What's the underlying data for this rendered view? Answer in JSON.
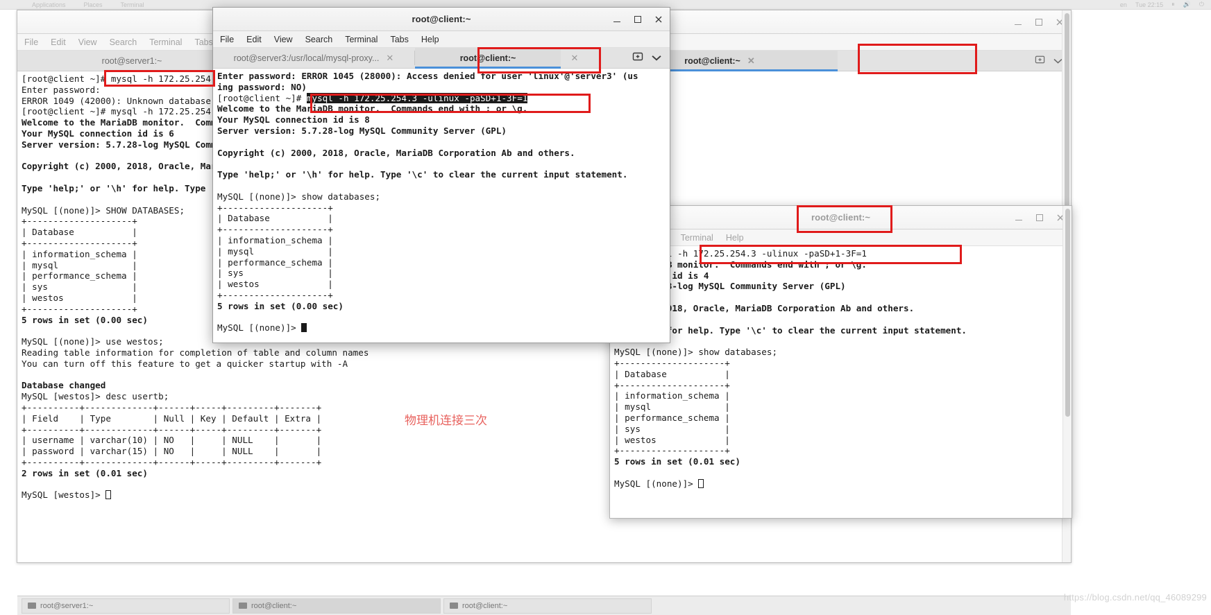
{
  "panel": {
    "menus": [
      "Applications",
      "Places",
      "Terminal"
    ],
    "right_items": [
      "en",
      "Tue 22:15",
      "⏸",
      "🔊",
      "⏻"
    ]
  },
  "window_back": {
    "title": "root@server1:~",
    "menubar": [
      "File",
      "Edit",
      "View",
      "Search",
      "Terminal",
      "Tabs",
      "Help"
    ],
    "tabs": [
      {
        "label": "root@server1:~",
        "active": false
      },
      {
        "label": "root@client:~",
        "active": true
      }
    ],
    "buttons": {
      "minimize": "minimize-icon",
      "maximize": "maximize-icon",
      "close": "close-icon"
    },
    "terminal_lines": [
      {
        "t": "[root@client ~]# mysql -h 172.25.254.3 -ulinux -pSD+1-3F=1 westoss",
        "bold": false
      },
      {
        "t": "Enter password:",
        "bold": false
      },
      {
        "t": "ERROR 1049 (42000): Unknown database 'westoss'",
        "bold": false
      },
      {
        "t": "[root@client ~]# mysql -h 172.25.254.3 -ulinux -pSD+1-3F=1",
        "bold": false
      },
      {
        "t": "Welcome to the MariaDB monitor.  Commands end with ; or \\g.",
        "bold": true
      },
      {
        "t": "Your MySQL connection id is 6",
        "bold": true
      },
      {
        "t": "Server version: 5.7.28-log MySQL Community Server (GPL)",
        "bold": true
      },
      {
        "t": "",
        "bold": false
      },
      {
        "t": "Copyright (c) 2000, 2018, Oracle, MariaDB Corporation Ab and others.",
        "bold": true
      },
      {
        "t": "",
        "bold": false
      },
      {
        "t": "Type 'help;' or '\\h' for help. Type '\\c' to clear the current input statement.",
        "bold": true
      },
      {
        "t": "",
        "bold": false
      },
      {
        "t": "MySQL [(none)]> SHOW DATABASES;",
        "bold": false
      },
      {
        "t": "+--------------------+",
        "bold": false
      },
      {
        "t": "| Database           |",
        "bold": false
      },
      {
        "t": "+--------------------+",
        "bold": false
      },
      {
        "t": "| information_schema |",
        "bold": false
      },
      {
        "t": "| mysql              |",
        "bold": false
      },
      {
        "t": "| performance_schema |",
        "bold": false
      },
      {
        "t": "| sys                |",
        "bold": false
      },
      {
        "t": "| westos             |",
        "bold": false
      },
      {
        "t": "+--------------------+",
        "bold": false
      },
      {
        "t": "5 rows in set (0.00 sec)",
        "bold": true
      },
      {
        "t": "",
        "bold": false
      },
      {
        "t": "MySQL [(none)]> use westos;",
        "bold": false
      },
      {
        "t": "Reading table information for completion of table and column names",
        "bold": false
      },
      {
        "t": "You can turn off this feature to get a quicker startup with -A",
        "bold": false
      },
      {
        "t": "",
        "bold": false
      },
      {
        "t": "Database changed",
        "bold": true
      },
      {
        "t": "MySQL [westos]> desc usertb;",
        "bold": false
      },
      {
        "t": "+----------+-------------+------+-----+---------+-------+",
        "bold": false
      },
      {
        "t": "| Field    | Type        | Null | Key | Default | Extra |",
        "bold": false
      },
      {
        "t": "+----------+-------------+------+-----+---------+-------+",
        "bold": false
      },
      {
        "t": "| username | varchar(10) | NO   |     | NULL    |       |",
        "bold": false
      },
      {
        "t": "| password | varchar(15) | NO   |     | NULL    |       |",
        "bold": false
      },
      {
        "t": "+----------+-------------+------+-----+---------+-------+",
        "bold": false
      },
      {
        "t": "2 rows in set (0.01 sec)",
        "bold": true
      },
      {
        "t": "",
        "bold": false
      },
      {
        "t": "MySQL [westos]> ",
        "bold": false,
        "cursor": "hollow"
      }
    ]
  },
  "window_center": {
    "title": "root@client:~",
    "menubar": [
      "File",
      "Edit",
      "View",
      "Search",
      "Terminal",
      "Tabs",
      "Help"
    ],
    "tabs": [
      {
        "label": "root@server3:/usr/local/mysql-proxy...",
        "active": false
      },
      {
        "label": "root@client:~",
        "active": true
      }
    ],
    "tab_tools": {
      "new_tab": "new-tab-icon",
      "tab_list": "chevron-down-icon"
    },
    "buttons": {
      "minimize": "minimize-icon",
      "maximize": "maximize-icon",
      "close": "close-icon"
    },
    "terminal_lines": [
      {
        "t": "Enter password: ERROR 1045 (28000): Access denied for user 'linux'@'server3' (us",
        "bold": true
      },
      {
        "t": "ing password: NO)",
        "bold": true
      },
      {
        "t": "[root@client ~]# ",
        "bold": false,
        "inv": "mysql -h 172.25.254.3 -ulinux -paSD+1-3F=1"
      },
      {
        "t": "Welcome to the MariaDB monitor.  Commands end with ; or \\g.",
        "bold": true
      },
      {
        "t": "Your MySQL connection id is 8",
        "bold": true
      },
      {
        "t": "Server version: 5.7.28-log MySQL Community Server (GPL)",
        "bold": true
      },
      {
        "t": "",
        "bold": false
      },
      {
        "t": "Copyright (c) 2000, 2018, Oracle, MariaDB Corporation Ab and others.",
        "bold": true
      },
      {
        "t": "",
        "bold": false
      },
      {
        "t": "Type 'help;' or '\\h' for help. Type '\\c' to clear the current input statement.",
        "bold": true
      },
      {
        "t": "",
        "bold": false
      },
      {
        "t": "MySQL [(none)]> show databases;",
        "bold": false
      },
      {
        "t": "+--------------------+",
        "bold": false
      },
      {
        "t": "| Database           |",
        "bold": false
      },
      {
        "t": "+--------------------+",
        "bold": false
      },
      {
        "t": "| information_schema |",
        "bold": false
      },
      {
        "t": "| mysql              |",
        "bold": false
      },
      {
        "t": "| performance_schema |",
        "bold": false
      },
      {
        "t": "| sys                |",
        "bold": false
      },
      {
        "t": "| westos             |",
        "bold": false
      },
      {
        "t": "+--------------------+",
        "bold": false
      },
      {
        "t": "5 rows in set (0.00 sec)",
        "bold": true
      },
      {
        "t": "",
        "bold": false
      },
      {
        "t": "MySQL [(none)]> ",
        "bold": false,
        "cursor": "solid"
      }
    ]
  },
  "window_right": {
    "title": "root@client:~",
    "menubar": [
      "ew",
      "Search",
      "Terminal",
      "Help"
    ],
    "buttons": {
      "minimize": "minimize-icon",
      "maximize": "maximize-icon",
      "close": "close-icon"
    },
    "terminal_lines": [
      {
        "t": "t ~]# mysql -h 172.25.254.3 -ulinux -paSD+1-3F=1",
        "bold": false
      },
      {
        "t": "the MariaDB monitor.  Commands end with ; or \\g.",
        "bold": true
      },
      {
        "t": "connection id is 4",
        "bold": true
      },
      {
        "t": "ion: 5.7.28-log MySQL Community Server (GPL)",
        "bold": true
      },
      {
        "t": "",
        "bold": false
      },
      {
        "t": "c) 2000, 2018, Oracle, MariaDB Corporation Ab and others.",
        "bold": true
      },
      {
        "t": "",
        "bold": false
      },
      {
        "t": "' or '\\h' for help. Type '\\c' to clear the current input statement.",
        "bold": true
      },
      {
        "t": "",
        "bold": false
      },
      {
        "t": "MySQL [(none)]> show databases;",
        "bold": false
      },
      {
        "t": "+--------------------+",
        "bold": false
      },
      {
        "t": "| Database           |",
        "bold": false
      },
      {
        "t": "+--------------------+",
        "bold": false
      },
      {
        "t": "| information_schema |",
        "bold": false
      },
      {
        "t": "| mysql              |",
        "bold": false
      },
      {
        "t": "| performance_schema |",
        "bold": false
      },
      {
        "t": "| sys                |",
        "bold": false
      },
      {
        "t": "| westos             |",
        "bold": false
      },
      {
        "t": "+--------------------+",
        "bold": false
      },
      {
        "t": "5 rows in set (0.01 sec)",
        "bold": true
      },
      {
        "t": "",
        "bold": false
      },
      {
        "t": "MySQL [(none)]> ",
        "bold": false,
        "cursor": "hollow"
      }
    ]
  },
  "annotations": {
    "note_text": "物理机连接三次",
    "highlight_color": "#e01b1b",
    "note_color": "#e8625e"
  },
  "taskbar": {
    "items": [
      "root@server1:~",
      "root@client:~",
      "root@client:~"
    ]
  },
  "watermark": "https://blog.csdn.net/qq_46089299"
}
